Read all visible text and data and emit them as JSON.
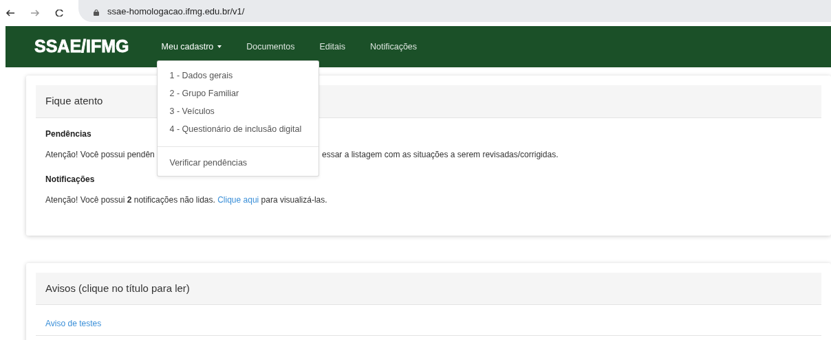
{
  "browser": {
    "url": "ssae-homologacao.ifmg.edu.br/v1/"
  },
  "navbar": {
    "brand": "SSAE/IFMG",
    "items": [
      {
        "label": "Meu cadastro",
        "kind": "dropdown",
        "expanded": true
      },
      {
        "label": "Documentos",
        "kind": "link"
      },
      {
        "label": "Editais",
        "kind": "link"
      },
      {
        "label": "Notificações",
        "kind": "link"
      }
    ]
  },
  "dropdown": {
    "items": [
      {
        "kind": "item",
        "label": "1 - Dados gerais"
      },
      {
        "kind": "item",
        "label": "2 - Grupo Familiar"
      },
      {
        "kind": "item",
        "label": "3 - Veículos"
      },
      {
        "kind": "item",
        "label": "4 - Questionário de inclusão digital"
      },
      {
        "kind": "divider"
      },
      {
        "kind": "item",
        "label": "Verificar pendências"
      }
    ]
  },
  "alert_card": {
    "title": "Fique atento",
    "sections": [
      {
        "heading": "Pendências",
        "fragments": [
          "Atenção! Você possui pendên",
          "essar a listagem com as situações a serem revisadas/corrigidas."
        ]
      },
      {
        "heading": "Notificações",
        "parts": [
          {
            "kind": "text",
            "text": "Atenção! Você possui **2** notificações não lidas. "
          },
          {
            "kind": "link",
            "text": "Clique aqui"
          },
          {
            "kind": "text",
            "text": " para visualizá-las."
          }
        ]
      }
    ]
  },
  "notices_card": {
    "title": "Avisos (clique no título para ler)",
    "items": [
      "Aviso de testes"
    ]
  }
}
